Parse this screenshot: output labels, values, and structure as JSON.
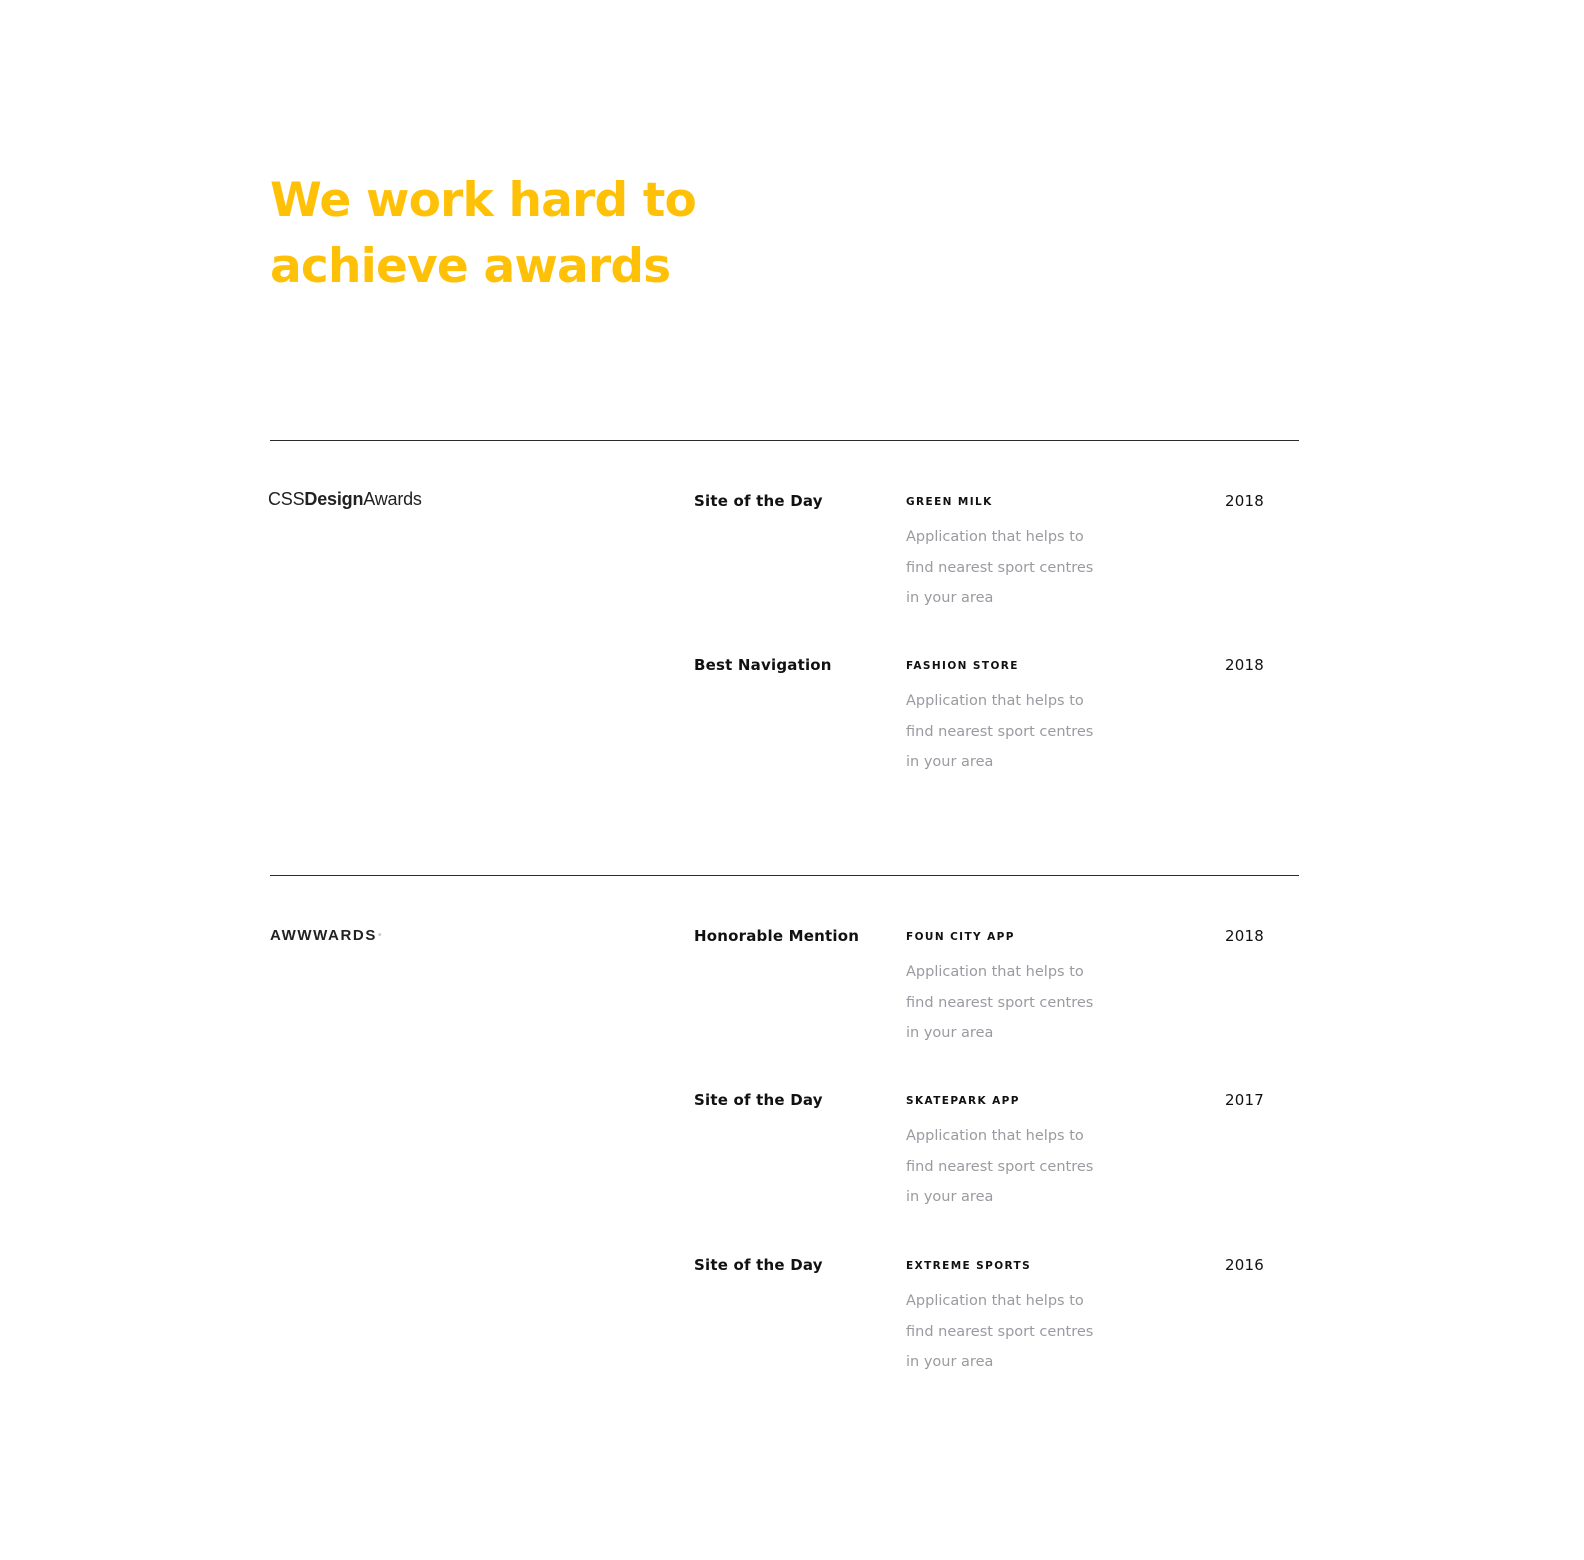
{
  "headline": {
    "line1": "We work hard to",
    "line2": "achieve awards"
  },
  "colors": {
    "accent": "#FFC107",
    "text": "#111111",
    "muted": "#9A9AA0",
    "divider": "#2B2B2B"
  },
  "sections": [
    {
      "logo": {
        "part1": "CSS",
        "part2": "Design",
        "part3": "Awards"
      },
      "entries": [
        {
          "award": "Site of the Day",
          "project": "GREEN MILK",
          "desc": [
            "Application that helps to",
            "find nearest sport centres",
            "in your area"
          ],
          "year": "2018"
        },
        {
          "award": "Best Navigation",
          "project": "FASHION STORE",
          "desc": [
            "Application that helps to",
            "find nearest sport centres",
            "in your area"
          ],
          "year": "2018"
        }
      ]
    },
    {
      "logo": {
        "text": "AWWWARDS",
        "dot": "•"
      },
      "entries": [
        {
          "award": "Honorable Mention",
          "project": "FOUN CITY APP",
          "desc": [
            "Application that helps to",
            "find nearest sport centres",
            "in your area"
          ],
          "year": "2018"
        },
        {
          "award": "Site of the Day",
          "project": "SKATEPARK APP",
          "desc": [
            "Application that helps to",
            "find nearest sport centres",
            "in your area"
          ],
          "year": "2017"
        },
        {
          "award": "Site of the Day",
          "project": "EXTREME SPORTS",
          "desc": [
            "Application that helps to",
            "find nearest sport centres",
            "in your area"
          ],
          "year": "2016"
        }
      ]
    }
  ]
}
